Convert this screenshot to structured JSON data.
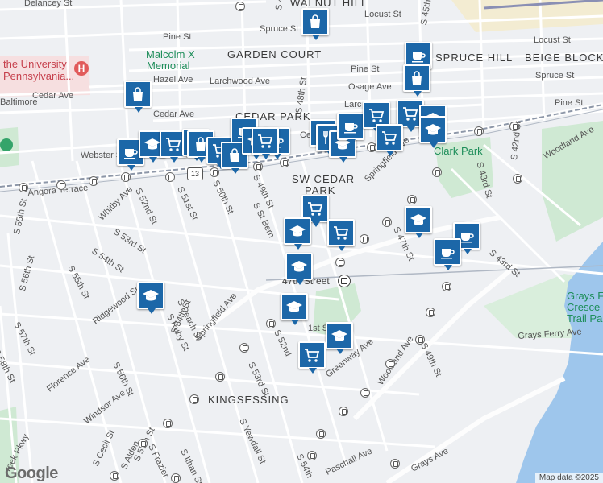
{
  "map": {
    "areas": {
      "walnut_hill": "WALNUT HILL",
      "garden_court": "GARDEN COURT",
      "spruce_hill": "SPRUCE HILL",
      "beige_block": "BEIGE BLOCK",
      "cedar_park": "CEDAR PARK",
      "sw_cedar_park_1": "SW CEDAR",
      "sw_cedar_park_2": "PARK",
      "kingsessing": "KINGSESSING"
    },
    "pois": {
      "malcolm_x_1": "Malcolm X",
      "malcolm_x_2": "Memorial",
      "univ_1": "the University",
      "univ_2": "Pennsylvania...",
      "clark_park": "Clark Park",
      "grays_ferry_1": "Grays Fe",
      "grays_ferry_2": "Cresce",
      "grays_ferry_3": "Trail Pa",
      "station_47": "47th Street"
    },
    "streets": {
      "delancey": "Delancey St",
      "walnut_st": "Walnut St",
      "locust_st_top": "Locust St",
      "spruce_st": "Spruce St",
      "pine_st": "Pine St",
      "hazel_ave": "Hazel Ave",
      "larchwood_ave": "Larchwood Ave",
      "cedar_ave_w": "Cedar Ave",
      "cedar_ave_c": "Cedar Ave",
      "baltimore_w": "Baltimore",
      "webster_st": "Webster St",
      "angora_terrace": "Angora Terrace",
      "whitby_ave": "Whitby Ave",
      "s55th": "S 55th St",
      "s56th": "S 56th St",
      "s54th_w": "S 54th St",
      "s52nd_w": "S 52nd St",
      "s51st_w": "S 51st St",
      "s50th": "S 50th St",
      "s49th": "S 49th St",
      "s48th": "S 48th St",
      "s53rd": "S 53rd St",
      "s_st_bern": "S St Bern",
      "s55th_b": "S 55th St",
      "s57th": "S 57th St",
      "ridgewood": "Ridgewood St",
      "florence": "Florence Ave",
      "windsor": "Windsor Ave",
      "peach": "S Peach St",
      "ruby": "S Ruby St",
      "s54th_c": "S 54th St",
      "s56th_c": "S 56th St",
      "springfield_c": "Springfield Ave",
      "springfield_e": "Springfield Ave",
      "s53rd_c": "S 53rd St",
      "s52nd_c": "S 52nd",
      "s51st_c": "1st St",
      "greenway": "Greenway Ave",
      "woodland_c": "Woodland Ave",
      "woodland_ne": "Woodland Ave",
      "s49th_se": "S 49th St",
      "grays_ferry_ave": "Grays Ferry Ave",
      "grays_ave": "Grays Ave",
      "yewdall": "S Yewdall St",
      "s54th_s": "S 54th",
      "paschall": "Paschall Ave",
      "frazier": "S Frazier",
      "s57th_s": "S 57th St",
      "alden": "S Alden",
      "cecil": "S Cecil St",
      "ithan": "S Ithan St",
      "s58th": "S 58th St",
      "reek_pkwy": "reek Pkwy",
      "s47th": "S 47th St",
      "s43rd_a": "S 43rd St",
      "s43rd_b": "S 43rd St",
      "s42nd": "S 42nd St",
      "s45th": "S 45th St",
      "locust_e": "Locust St",
      "spruce_e": "Spruce St",
      "pine_e": "Pine St",
      "osage": "Osage Ave",
      "larc": "Larc",
      "pine_c": "Pine St",
      "pine_w": "Pine St",
      "s4_top": "S 4",
      "cedar_c2": "Ce"
    },
    "route_13": "13",
    "attribution": "Map data ©2025",
    "logo": "Google",
    "marker_color": "#1c67a8",
    "park_color": "#cfe9d3",
    "water_color": "#9ec6ec",
    "markers": [
      {
        "icon": "shopping-bag-icon"
      },
      {
        "icon": "shopping-bag-icon"
      },
      {
        "icon": "cafe-icon"
      },
      {
        "icon": "shopping-bag-icon"
      },
      {
        "icon": "cafe-icon"
      },
      {
        "icon": "school-icon"
      },
      {
        "icon": "grocery-cart-icon"
      },
      {
        "icon": "grocery-cart-icon"
      },
      {
        "icon": "shopping-bag-icon"
      },
      {
        "icon": "grocery-cart-icon"
      },
      {
        "icon": "cafe-icon"
      },
      {
        "icon": "cafe-icon"
      },
      {
        "icon": "shopping-bag-icon"
      },
      {
        "icon": "school-icon"
      },
      {
        "icon": "grocery-cart-icon"
      },
      {
        "icon": "grocery-cart-icon"
      },
      {
        "icon": "restaurant-icon"
      },
      {
        "icon": "school-icon"
      },
      {
        "icon": "cafe-icon"
      },
      {
        "icon": "grocery-cart-icon"
      },
      {
        "icon": "grocery-cart-icon"
      },
      {
        "icon": "school-icon"
      },
      {
        "icon": "school-icon"
      },
      {
        "icon": "grocery-cart-icon"
      },
      {
        "icon": "school-icon"
      },
      {
        "icon": "school-icon"
      },
      {
        "icon": "school-icon"
      },
      {
        "icon": "school-icon"
      },
      {
        "icon": "cafe-icon"
      },
      {
        "icon": "cafe-icon"
      },
      {
        "icon": "school-icon"
      },
      {
        "icon": "school-icon"
      },
      {
        "icon": "grocery-cart-icon"
      }
    ]
  }
}
